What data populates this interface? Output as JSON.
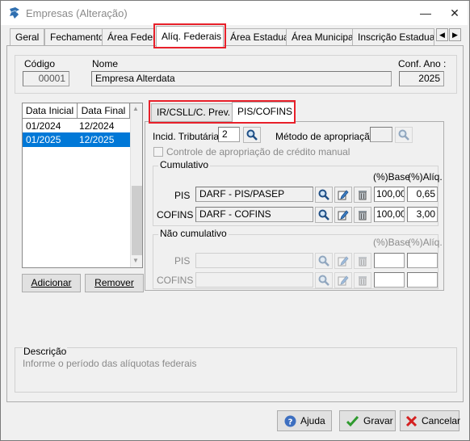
{
  "window": {
    "title": "Empresas (Alteração)",
    "minimize": "—",
    "close": "✕"
  },
  "tabs": [
    {
      "label": "Geral"
    },
    {
      "label": "Fechamento"
    },
    {
      "label": "Área Federa"
    },
    {
      "label": "Alíq. Federais"
    },
    {
      "label": "Área Estadual"
    },
    {
      "label": "Área Municipal"
    },
    {
      "label": "Inscrição Estadual S"
    }
  ],
  "header": {
    "codigo_label": "Código",
    "codigo_value": "00001",
    "nome_label": "Nome",
    "nome_value": "Empresa Alterdata",
    "ano_label": "Conf. Ano :",
    "ano_value": "2025"
  },
  "periods": {
    "col_inicial": "Data Inicial",
    "col_final": "Data Final",
    "rows": [
      {
        "inicial": "01/2024",
        "final": "12/2024",
        "selected": false
      },
      {
        "inicial": "01/2025",
        "final": "12/2025",
        "selected": true
      }
    ],
    "add_button": "Adicionar",
    "remove_button": "Remover"
  },
  "subtabs": [
    {
      "label": "IR/CSLL/C. Prev."
    },
    {
      "label": "PIS/COFINS"
    }
  ],
  "piscofins": {
    "incid_label": "Incid. Tributária:",
    "incid_value": "2",
    "metodo_label": "Método de apropriação:",
    "metodo_value": "",
    "controle_label": "Controle de apropriação de crédito manual",
    "cumulativo": {
      "title": "Cumulativo",
      "base_header": "(%)Base",
      "aliq_header": "(%)Alíq.",
      "rows": [
        {
          "label": "PIS",
          "value": "DARF - PIS/PASEP",
          "base": "100,00",
          "aliq": "0,65"
        },
        {
          "label": "COFINS",
          "value": "DARF - COFINS",
          "base": "100,00",
          "aliq": "3,00"
        }
      ]
    },
    "nao_cumulativo": {
      "title": "Não cumulativo",
      "base_header": "(%)Base",
      "aliq_header": "(%)Alíq.",
      "rows": [
        {
          "label": "PIS",
          "value": "",
          "base": "",
          "aliq": ""
        },
        {
          "label": "COFINS",
          "value": "",
          "base": "",
          "aliq": ""
        }
      ]
    }
  },
  "description": {
    "title": "Descrição",
    "text": "Informe o período das alíquotas federais"
  },
  "footer": {
    "help": "Ajuda",
    "save": "Gravar",
    "cancel": "Cancelar"
  },
  "colors": {
    "highlight": "#e8202a",
    "selection": "#0078d7"
  }
}
